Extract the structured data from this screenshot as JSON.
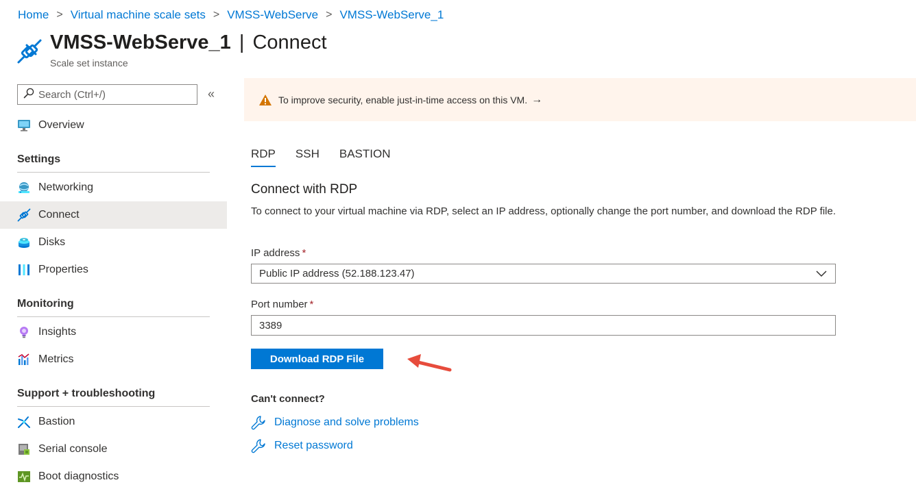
{
  "breadcrumb": {
    "items": [
      "Home",
      "Virtual machine scale sets",
      "VMSS-WebServe",
      "VMSS-WebServe_1"
    ],
    "separator": ">"
  },
  "header": {
    "resource_name": "VMSS-WebServe_1",
    "separator": "|",
    "blade_name": "Connect",
    "subtitle": "Scale set instance",
    "icon": "plug-icon"
  },
  "sidebar": {
    "search_placeholder": "Search (Ctrl+/)",
    "collapse_glyph": "«",
    "top_items": [
      {
        "label": "Overview",
        "icon": "monitor-icon"
      }
    ],
    "sections": [
      {
        "heading": "Settings",
        "items": [
          {
            "label": "Networking",
            "icon": "globe-network-icon"
          },
          {
            "label": "Connect",
            "icon": "plug-icon",
            "active": true
          },
          {
            "label": "Disks",
            "icon": "disk-stack-icon"
          },
          {
            "label": "Properties",
            "icon": "bars-icon"
          }
        ]
      },
      {
        "heading": "Monitoring",
        "items": [
          {
            "label": "Insights",
            "icon": "lightbulb-icon"
          },
          {
            "label": "Metrics",
            "icon": "bar-chart-icon"
          }
        ]
      },
      {
        "heading": "Support + troubleshooting",
        "items": [
          {
            "label": "Bastion",
            "icon": "bastion-icon"
          },
          {
            "label": "Serial console",
            "icon": "console-icon"
          },
          {
            "label": "Boot diagnostics",
            "icon": "pulse-icon"
          }
        ]
      }
    ]
  },
  "banner": {
    "text": "To improve security, enable just-in-time access on this VM.",
    "arrow": "→",
    "icon": "warning-icon"
  },
  "tabs": [
    {
      "label": "RDP",
      "active": true
    },
    {
      "label": "SSH",
      "active": false
    },
    {
      "label": "BASTION",
      "active": false
    }
  ],
  "rdp": {
    "title": "Connect with RDP",
    "description": "To connect to your virtual machine via RDP, select an IP address, optionally change the port number, and download the RDP file.",
    "ip_label": "IP address",
    "ip_value": "Public IP address (52.188.123.47)",
    "port_label": "Port number",
    "port_value": "3389",
    "required_marker": "*",
    "download_label": "Download RDP File"
  },
  "troubleshoot": {
    "heading": "Can't connect?",
    "links": [
      {
        "label": "Diagnose and solve problems",
        "icon": "wrench-icon"
      },
      {
        "label": "Reset password",
        "icon": "wrench-icon"
      }
    ]
  },
  "colors": {
    "accent": "#0078d4",
    "banner_bg": "#fff4ec",
    "warning": "#d47500",
    "required": "#a4262c",
    "callout_arrow": "#e74c3c"
  }
}
